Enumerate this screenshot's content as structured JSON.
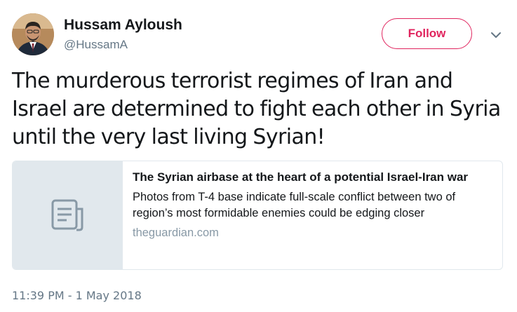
{
  "user": {
    "display_name": "Hussam Ayloush",
    "handle": "@HussamA"
  },
  "actions": {
    "follow_label": "Follow"
  },
  "tweet": {
    "text": "The murderous terrorist regimes of Iran and Israel are determined to fight each other in Syria until the very last living Syrian!",
    "timestamp": "11:39 PM - 1 May 2018"
  },
  "card": {
    "title": "The Syrian airbase at the heart of a potential Israel-Iran war",
    "description": "Photos from T-4 base indicate full-scale conflict between two of region’s most formidable enemies could be edging closer",
    "domain": "theguardian.com",
    "thumb_icon": "document-icon"
  },
  "colors": {
    "accent": "#e0245e",
    "text": "#14171a",
    "secondary": "#657786",
    "border": "#e1e8ed"
  }
}
